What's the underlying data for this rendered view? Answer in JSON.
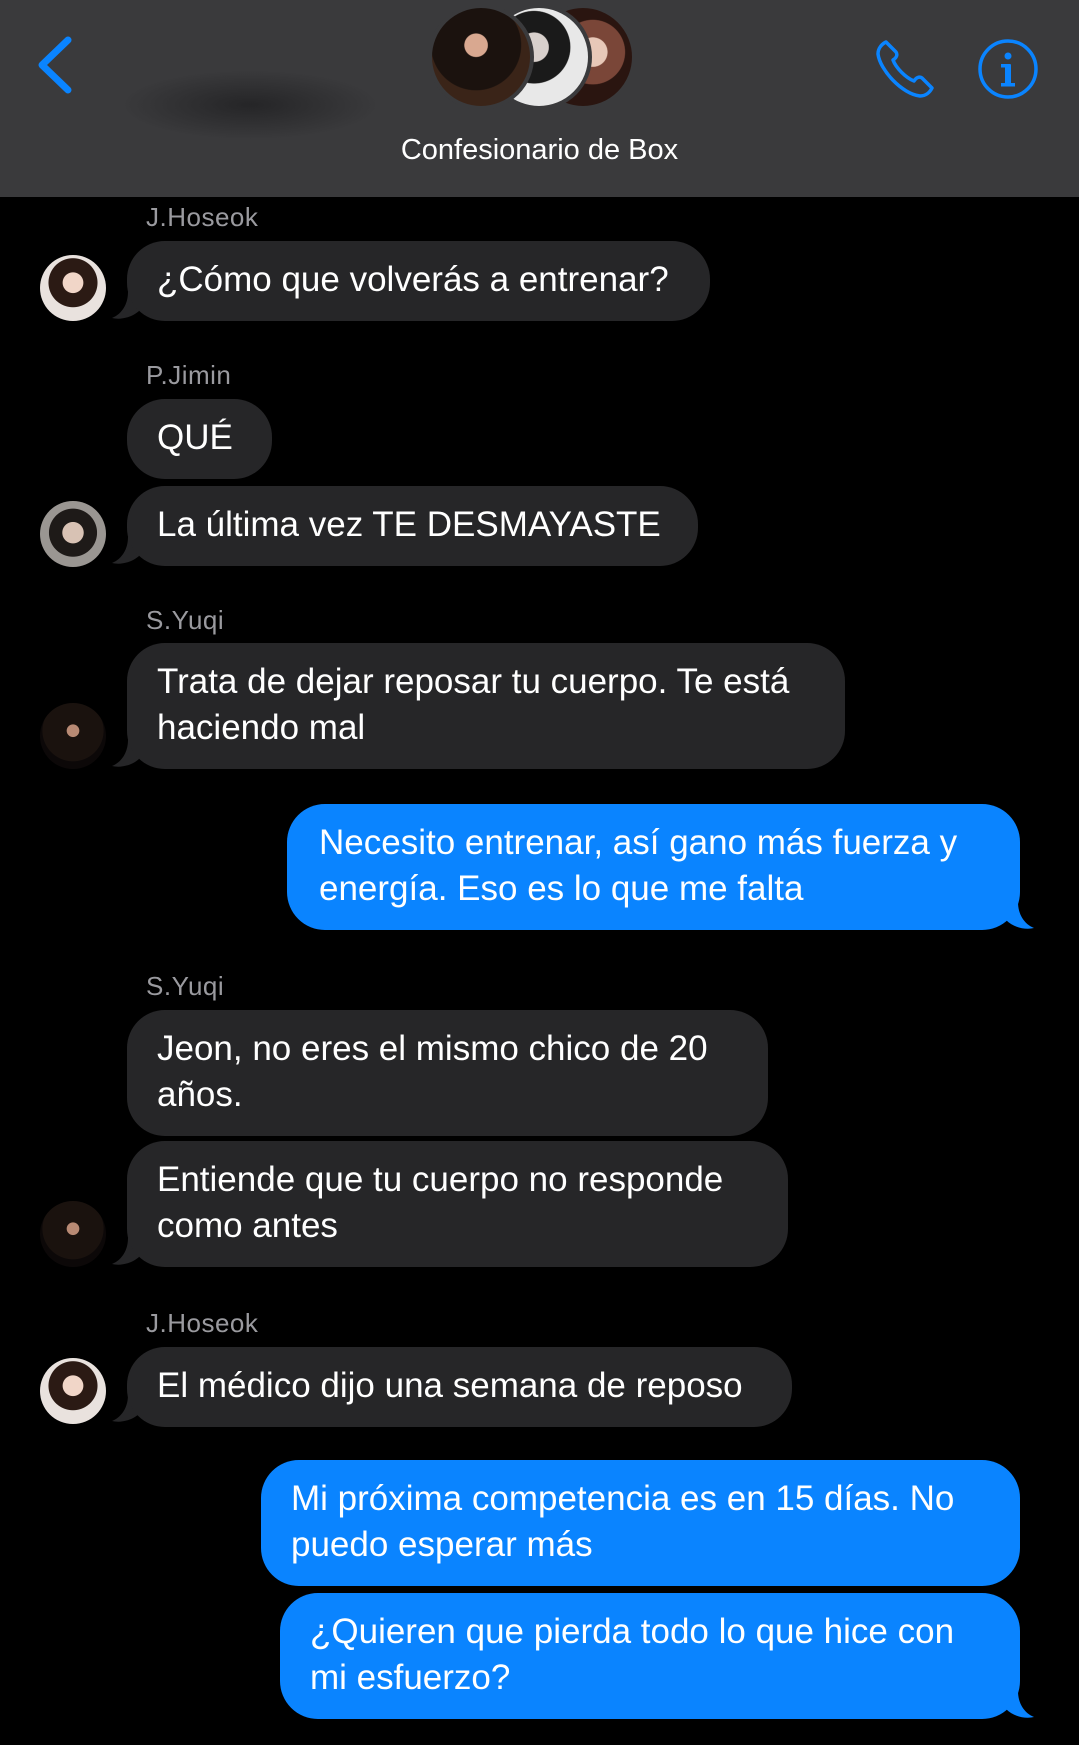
{
  "header": {
    "title": "Confesionario de Box",
    "back_icon": "chevron-left-icon",
    "call_icon": "phone-icon",
    "info_icon": "info-circle-icon",
    "accent_color": "#0a84ff"
  },
  "messages": [
    {
      "sender": "J.Hoseok",
      "direction": "in",
      "lines": [
        "¿Cómo que volverás a entrenar?"
      ]
    },
    {
      "sender": "P.Jimin",
      "direction": "in",
      "lines": [
        "QUÉ"
      ]
    },
    {
      "sender": "P.Jimin",
      "direction": "in",
      "lines": [
        "La última vez TE DESMAYASTE"
      ]
    },
    {
      "sender": "S.Yuqi",
      "direction": "in",
      "lines": [
        "Trata de dejar reposar tu cuerpo. Te está",
        "haciendo mal"
      ]
    },
    {
      "sender": "",
      "direction": "out",
      "lines": [
        "Necesito entrenar, así gano más fuerza y",
        "energía. Eso es lo que me falta"
      ]
    },
    {
      "sender": "S.Yuqi",
      "direction": "in",
      "lines": [
        "Jeon, no eres el mismo chico de 20",
        "años."
      ]
    },
    {
      "sender": "S.Yuqi",
      "direction": "in",
      "lines": [
        "Entiende que tu cuerpo no responde",
        "como antes"
      ]
    },
    {
      "sender": "J.Hoseok",
      "direction": "in",
      "lines": [
        "El médico dijo una semana de reposo"
      ]
    },
    {
      "sender": "",
      "direction": "out",
      "lines": [
        "Mi próxima competencia es en 15 días. No",
        "puedo esperar más"
      ]
    },
    {
      "sender": "",
      "direction": "out",
      "lines": [
        "¿Quieren que pierda todo lo que hice con",
        "mi esfuerzo?"
      ]
    }
  ],
  "colors": {
    "incoming_bubble": "#262628",
    "outgoing_bubble": "#0a84ff",
    "header_bg": "#3a3a3c",
    "sender_name": "#9a9a9f"
  }
}
